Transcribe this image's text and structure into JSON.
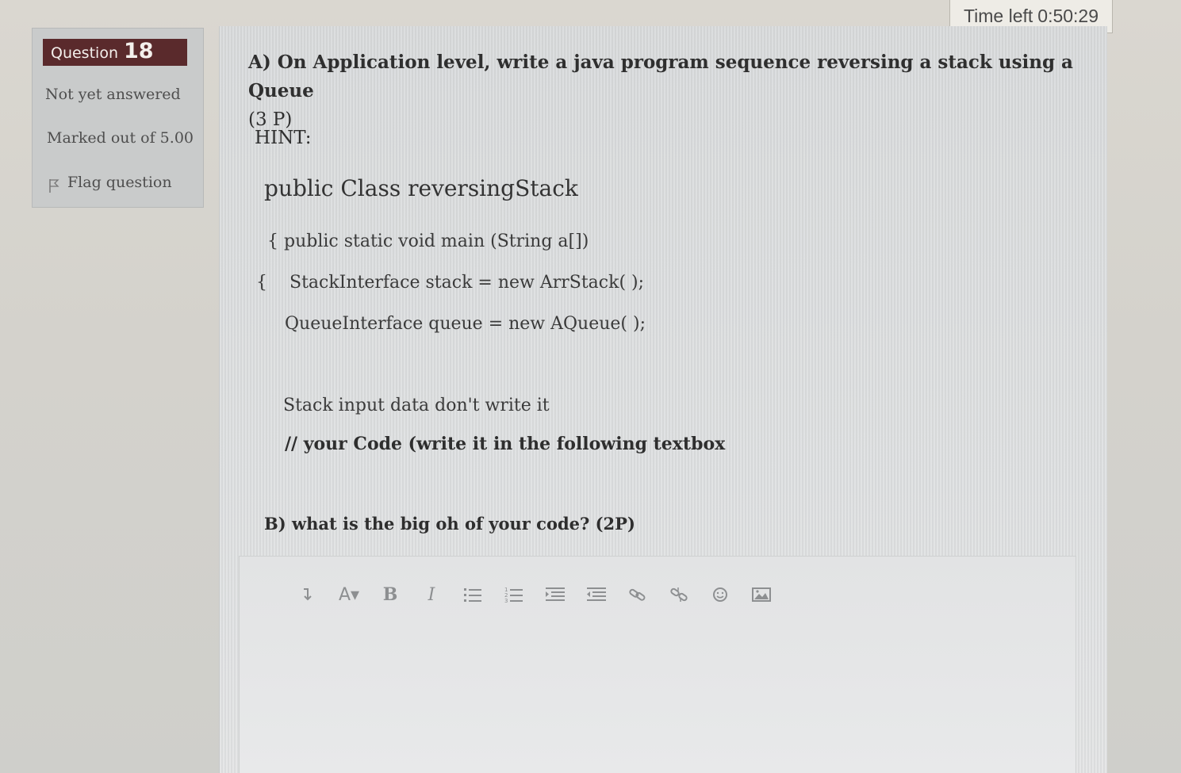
{
  "timer": {
    "label": "Time left",
    "value": "0:50:29"
  },
  "question_info": {
    "label": "Question",
    "number": "18",
    "state": "Not yet answered",
    "grade": "Marked out of 5.00",
    "flag_label": "Flag question"
  },
  "question": {
    "part_a": "A) On Application level, write a java program sequence reversing a stack using a Queue",
    "part_a_marks": "(3 P)",
    "hint_label": "HINT:",
    "code": {
      "class_decl": "public Class reversingStack",
      "main_decl": "{ public static void main (String a[])",
      "brace": "{",
      "stack_line": "StackInterface stack = new ArrStack( );",
      "queue_line": "QueueInterface  queue = new AQueue( );",
      "comment1": "Stack input data don't write it",
      "comment2": "// your Code (write it in the following  textbox"
    },
    "part_b": "B) what is the big oh of your code? (2P)"
  },
  "editor": {
    "toolbar": [
      {
        "icon": "toolbar-toggle-icon",
        "label": "↧"
      },
      {
        "icon": "font-style-icon",
        "label": "A▾"
      },
      {
        "icon": "bold-icon",
        "label": "B"
      },
      {
        "icon": "italic-icon",
        "label": "I"
      },
      {
        "icon": "unordered-list-icon",
        "label": ""
      },
      {
        "icon": "ordered-list-icon",
        "label": ""
      },
      {
        "icon": "indent-icon",
        "label": ""
      },
      {
        "icon": "outdent-icon",
        "label": ""
      },
      {
        "icon": "link-icon",
        "label": ""
      },
      {
        "icon": "unlink-icon",
        "label": ""
      },
      {
        "icon": "emoticon-icon",
        "label": ""
      },
      {
        "icon": "image-icon",
        "label": ""
      }
    ]
  }
}
